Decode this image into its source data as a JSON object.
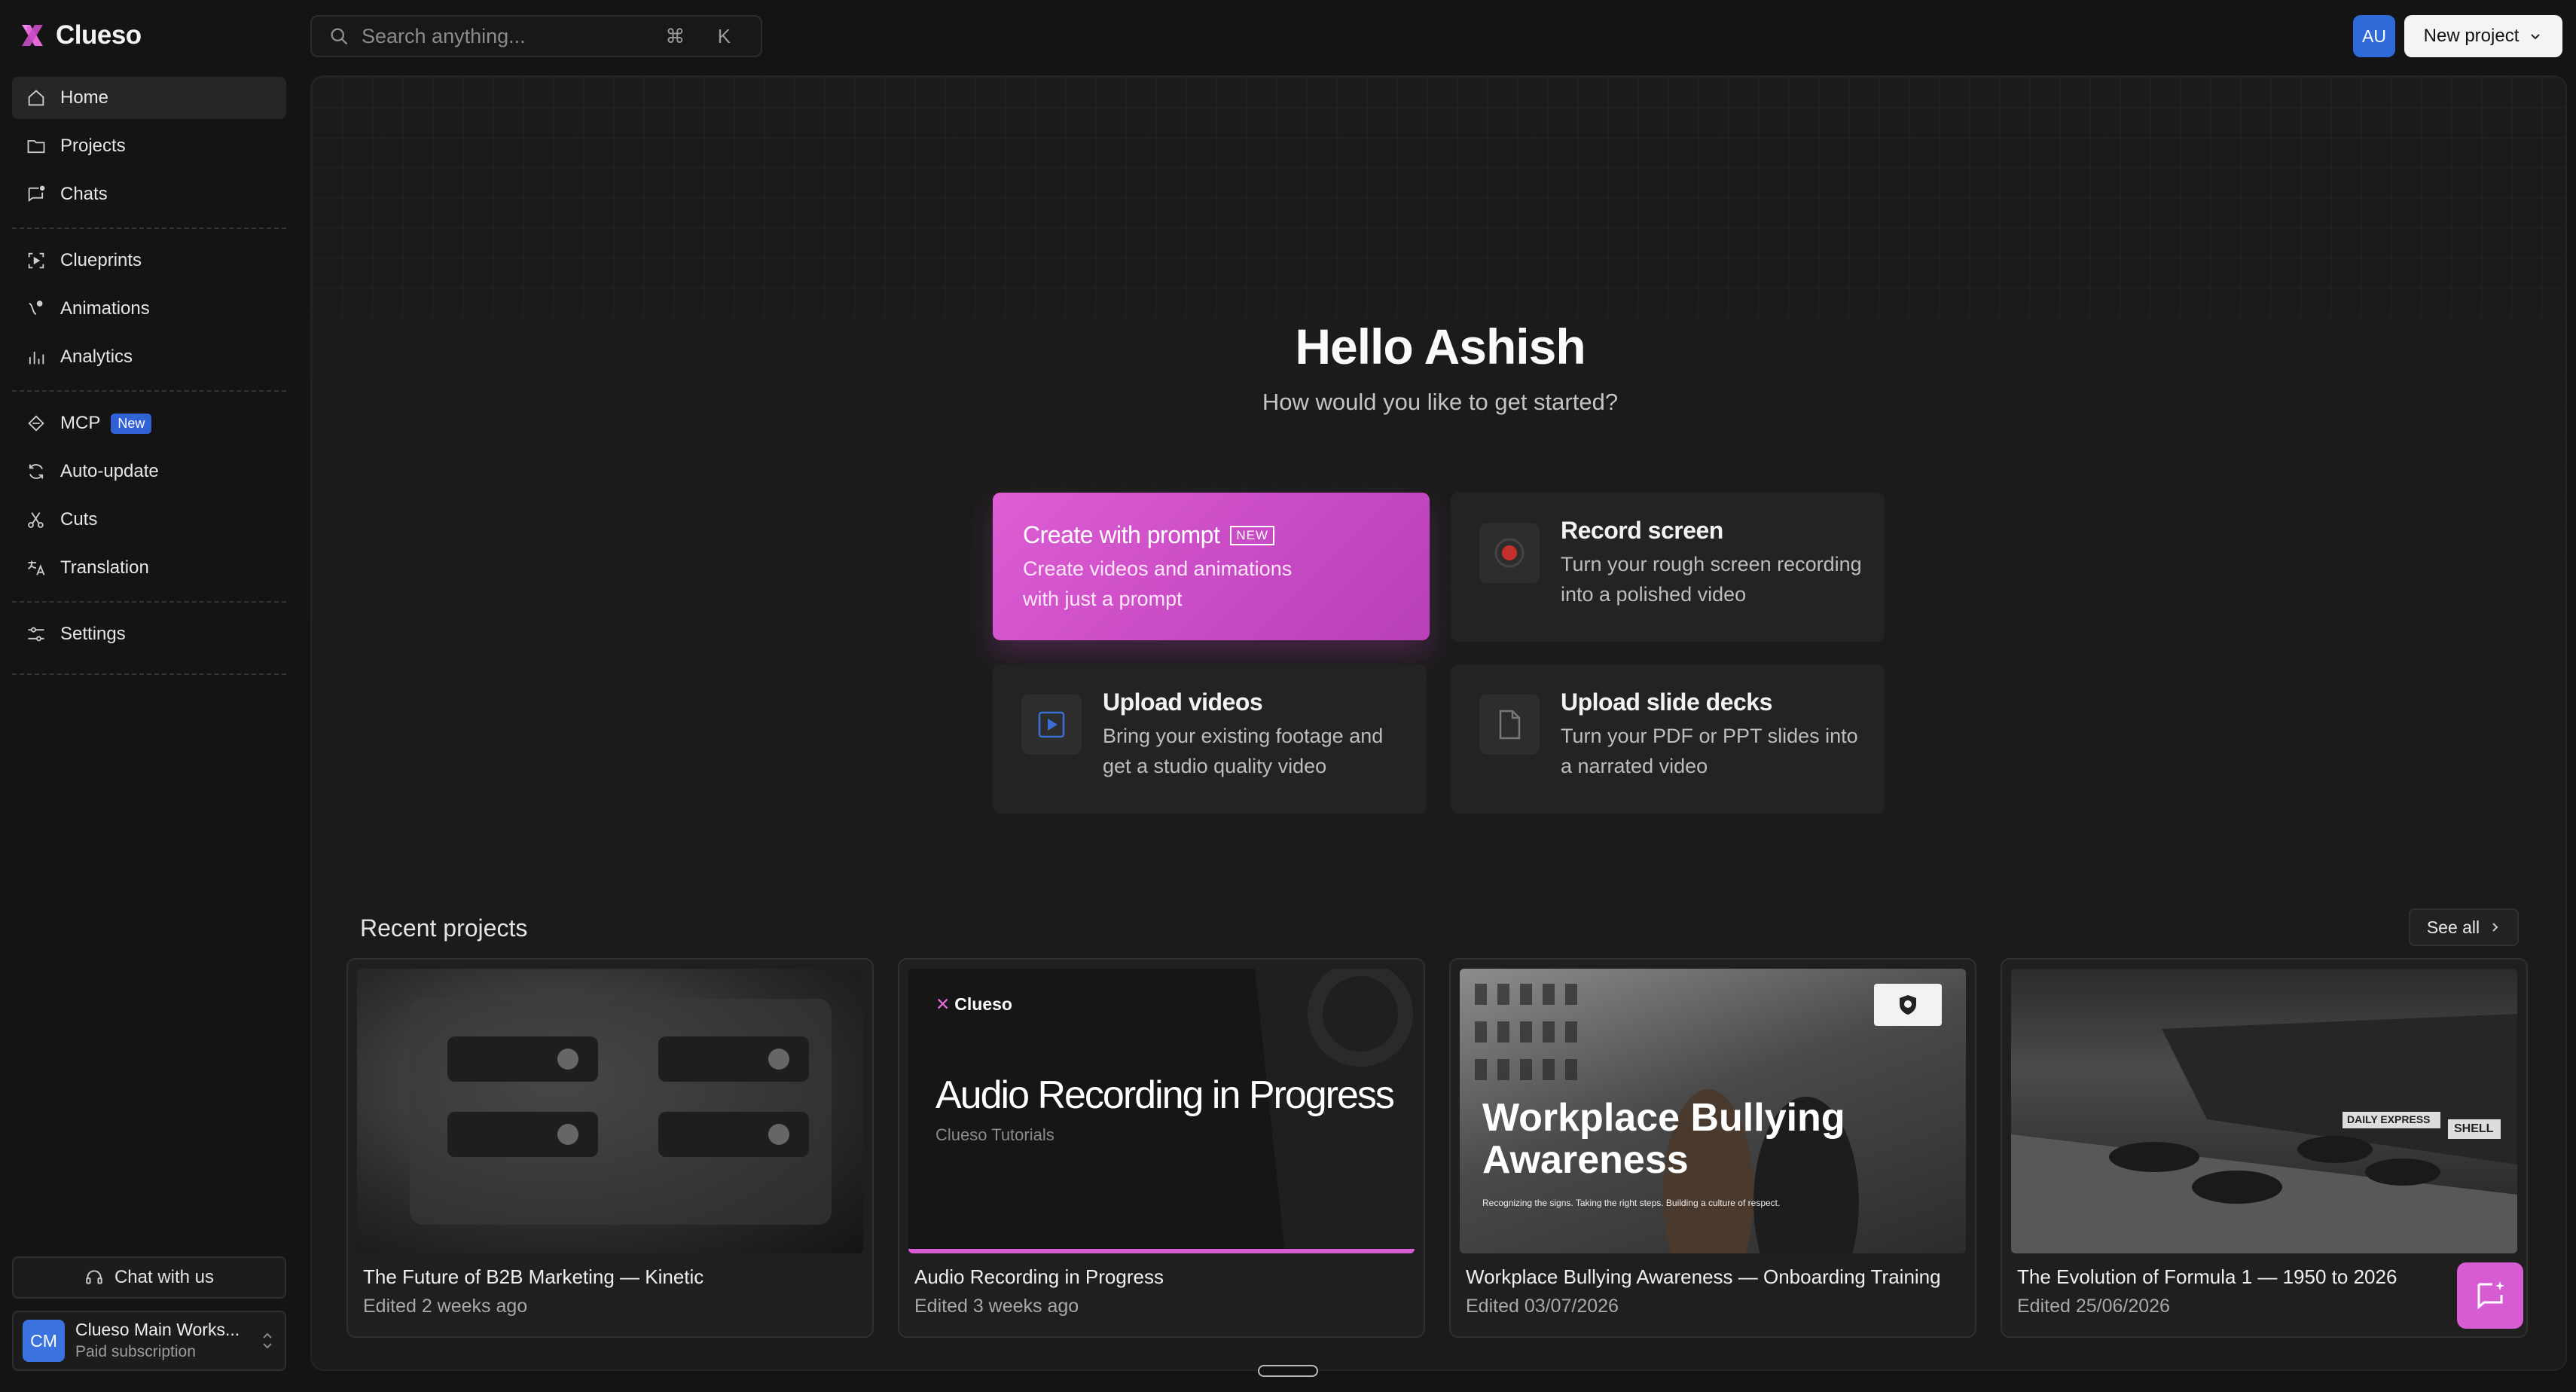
{
  "app": {
    "name": "Clueso"
  },
  "search": {
    "placeholder": "Search anything...",
    "shortcut": "⌘ K"
  },
  "header": {
    "avatar_initials": "AU",
    "new_project_label": "New project"
  },
  "sidebar": {
    "items": [
      {
        "label": "Home",
        "icon": "home-icon",
        "active": true
      },
      {
        "label": "Projects",
        "icon": "folder-icon"
      },
      {
        "label": "Chats",
        "icon": "chat-icon"
      },
      {
        "label": "Clueprints",
        "icon": "clueprint-icon"
      },
      {
        "label": "Animations",
        "icon": "animation-icon"
      },
      {
        "label": "Analytics",
        "icon": "analytics-icon"
      },
      {
        "label": "MCP",
        "icon": "mcp-icon",
        "badge": "New"
      },
      {
        "label": "Auto-update",
        "icon": "refresh-icon"
      },
      {
        "label": "Cuts",
        "icon": "scissors-icon"
      },
      {
        "label": "Translation",
        "icon": "translate-icon"
      },
      {
        "label": "Settings",
        "icon": "sliders-icon"
      }
    ],
    "chat_label": "Chat with us",
    "workspace": {
      "initials": "CM",
      "name": "Clueso Main Works...",
      "plan": "Paid subscription"
    }
  },
  "hero": {
    "greeting": "Hello Ashish",
    "subtitle": "How would you like to get started?"
  },
  "actions": {
    "prompt": {
      "title": "Create with prompt",
      "tag": "NEW",
      "desc": "Create videos and animations with just a prompt"
    },
    "record": {
      "title": "Record screen",
      "desc": "Turn your rough screen recording into a polished video"
    },
    "upload": {
      "title": "Upload videos",
      "desc": "Bring your existing footage and get a studio quality video"
    },
    "slides": {
      "title": "Upload slide decks",
      "desc": "Turn your PDF or PPT slides into a narrated video"
    }
  },
  "recent": {
    "title": "Recent projects",
    "see_all": "See all",
    "projects": [
      {
        "name": "The Future of B2B Marketing — Kinetic",
        "edited": "Edited 2 weeks ago"
      },
      {
        "name": "Audio Recording in Progress",
        "edited": "Edited 3 weeks ago",
        "thumb_title": "Audio Recording in Progress",
        "thumb_sub": "Clueso Tutorials",
        "thumb_brand": "Clueso"
      },
      {
        "name": "Workplace Bullying Awareness — Onboarding Training",
        "edited": "Edited 03/07/2026",
        "thumb_title": "Workplace Bullying Awareness",
        "thumb_sub": "Recognizing the signs. Taking the right steps. Building a culture of respect."
      },
      {
        "name": "The Evolution of Formula 1 — 1950 to 2026",
        "edited": "Edited 25/06/2026",
        "thumb_signs": [
          "DAILY EXPRESS",
          "SHELL"
        ]
      }
    ]
  },
  "colors": {
    "accent": "#d75bd2",
    "brand_blue": "#3261d6",
    "bg": "#141414"
  }
}
